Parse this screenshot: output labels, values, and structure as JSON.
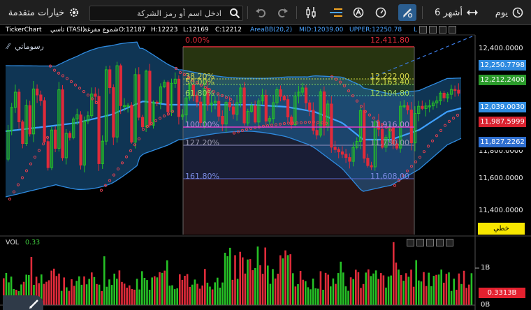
{
  "toolbar": {
    "advanced_options_label": "خيارات متقدمة",
    "search_placeholder": "ادخل اسم أو رمز الشركة",
    "period_label": "6 أشهر",
    "interval_label": "يوم"
  },
  "info": {
    "brand": "TickerChart",
    "symbol": "تاسي (TASI)",
    "candle_type": "شموع مفرغة",
    "open": "O:12187",
    "high": "H:12223",
    "low": "L:12169",
    "close": "C:12212",
    "indicator": "AreaBB(20,2)",
    "mid": "MID:12039.00",
    "upper": "UPPER:12250.78",
    "lower_prefix": "L"
  },
  "chart": {
    "drawings_label": "رسوماتي",
    "linear_label": "خطي",
    "price_axis": [
      "12,400.0000",
      "11,600.0000",
      "11,400.0000"
    ],
    "price_axis_partial": "11,800.0000",
    "fib_levels": [
      {
        "pct": "0.00%",
        "price": "12,411.80"
      },
      {
        "pct": "38.20%",
        "price": "12,222.00"
      },
      {
        "pct": "50.00%",
        "price": "12,163.40"
      },
      {
        "pct": "61.80%",
        "price": "12,104.80"
      },
      {
        "pct": "100.00%",
        "price": "11,916.00"
      },
      {
        "pct": "127.20%",
        "price": "11,780.00"
      },
      {
        "pct": "161.80%",
        "price": "11,608.00"
      }
    ],
    "tags": {
      "upper": "12,250.7798",
      "last": "12,212.2400",
      "mid": "12,039.0030",
      "hline": "11,987.5999",
      "lower": "11,827.2262"
    },
    "colors": {
      "up": "#26c126",
      "down": "#e02b3a",
      "band": "#2f8be0",
      "accent_yellow": "#f7e600"
    }
  },
  "volume": {
    "label": "VOL",
    "value": "0.33",
    "axis_top": "1B",
    "axis_bottom": "0B",
    "last_tag": "0.3313B"
  },
  "chart_data": {
    "type": "candlestick",
    "series": [
      {
        "name": "AreaBB(20,2) MID",
        "last": 12039.0
      },
      {
        "name": "AreaBB(20,2) UPPER",
        "last": 12250.78
      }
    ],
    "last_close": 12212.24,
    "ylim": [
      11300,
      12500
    ]
  }
}
